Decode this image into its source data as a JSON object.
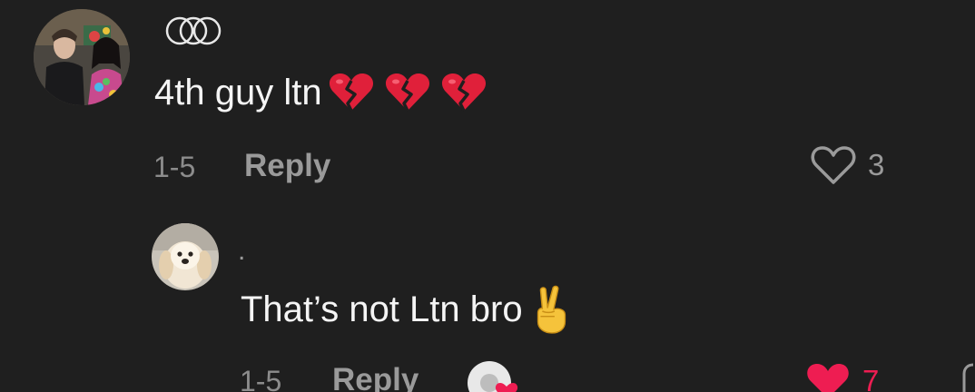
{
  "comment": {
    "username_icon": "three-rings-icon",
    "avatar": "user-avatar",
    "text": "4th guy ltn",
    "emojis": [
      "broken-heart-emoji",
      "broken-heart-emoji",
      "broken-heart-emoji"
    ],
    "date": "1-5",
    "reply_label": "Reply",
    "like_icon": "heart-outline-icon",
    "like_count": "3"
  },
  "reply": {
    "username": ".",
    "avatar": "puppy-avatar",
    "text": "That’s not Ltn bro",
    "emoji": "victory-hand-emoji",
    "date": "1-5",
    "reply_label": "Reply",
    "creator_icon": "creator-liked-icon",
    "like_icon": "heart-filled-icon",
    "like_count": "7",
    "accent_color": "#ee1d52"
  }
}
